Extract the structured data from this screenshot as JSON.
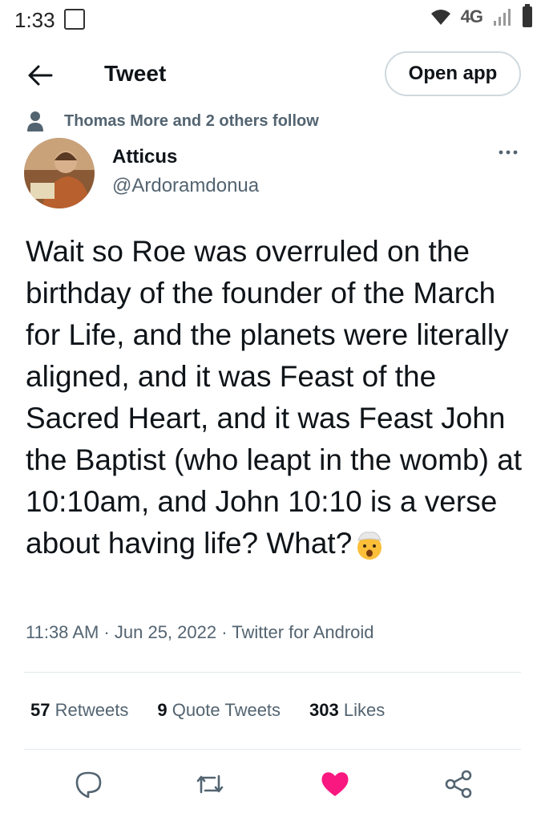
{
  "status_bar": {
    "time": "1:33",
    "network": "4G"
  },
  "header": {
    "back_icon": "arrow-left-icon",
    "title": "Tweet",
    "open_app_label": "Open app"
  },
  "social_context": {
    "icon": "person-icon",
    "text": "Thomas More and 2 others follow"
  },
  "author": {
    "name": "Atticus",
    "handle": "@Ardoramdonua",
    "more_icon": "more-horizontal-icon"
  },
  "tweet": {
    "text": "Wait so Roe was overruled on the birthday of the founder of the March for Life, and the planets were literally aligned, and it was Feast of the Sacred Heart, and it was Feast John the Baptist (who leapt in the womb) at 10:10am, and John 10:10 is a verse about having life? What?",
    "emoji": "exploding-head-emoji",
    "timestamp": "11:38 AM · Jun 25, 2022 · Twitter for Android"
  },
  "stats": {
    "retweets_count": "57",
    "retweets_label": "Retweets",
    "quotes_count": "9",
    "quotes_label": "Quote Tweets",
    "likes_count": "303",
    "likes_label": "Likes"
  },
  "actions": {
    "reply_icon": "reply-icon",
    "retweet_icon": "retweet-icon",
    "like_icon": "heart-icon",
    "share_icon": "share-icon",
    "like_color": "#f91880"
  }
}
